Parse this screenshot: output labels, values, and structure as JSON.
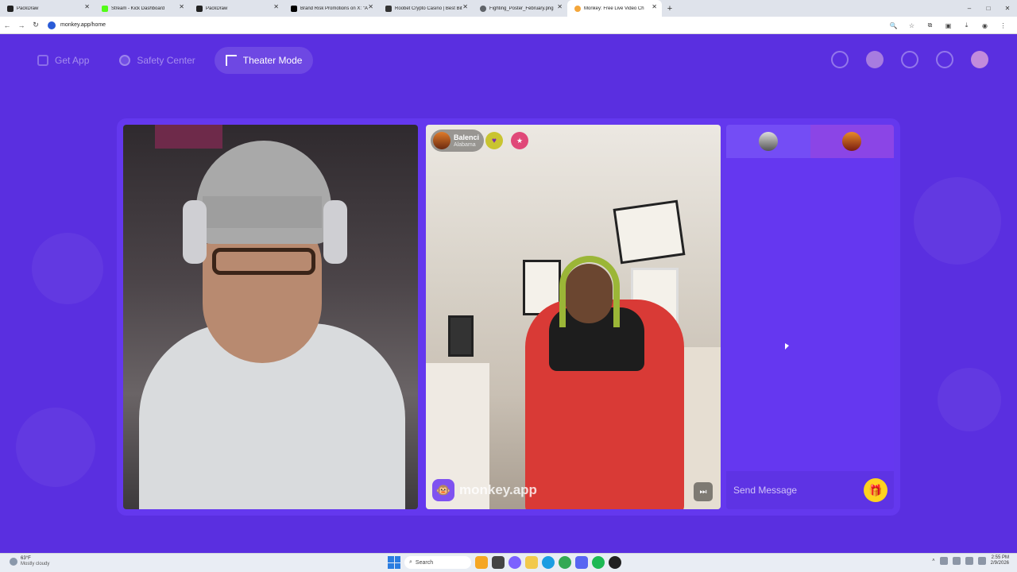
{
  "browser": {
    "tabs": [
      {
        "title": "PackDraw",
        "color": "#222222"
      },
      {
        "title": "Stream - Kick Dashboard",
        "color": "#53fc18"
      },
      {
        "title": "PackDraw",
        "color": "#222222"
      },
      {
        "title": "Brand Risk Promotions on X: \"A",
        "color": "#000000"
      },
      {
        "title": "Roobet Crypto Casino | Best Bit",
        "color": "#333333"
      },
      {
        "title": "Fighting_Poster_February.png",
        "color": "#5f6368"
      },
      {
        "title": "Monkey: Free Live Video Ch",
        "color": "#f4a63a"
      }
    ],
    "new_tab": "+",
    "url": "monkey.app/home",
    "window_controls": [
      "–",
      "□",
      "✕"
    ]
  },
  "app": {
    "nav": {
      "get_app": "Get App",
      "safety_center": "Safety Center",
      "theater_mode": "Theater Mode"
    },
    "right_video": {
      "user_name": "Balenci",
      "user_location": "Alabama",
      "watermark": "monkey.app",
      "skip_icon": "⏭"
    },
    "chat": {
      "placeholder": "Send Message",
      "gift_icon": "🎁"
    },
    "colors": {
      "background": "#5a2fe0",
      "stage": "#6438ee",
      "gift": "#ffd21f"
    }
  },
  "taskbar": {
    "weather_temp": "63°F",
    "weather_desc": "Mostly cloudy",
    "search": "Search",
    "time": "2:55 PM",
    "date": "2/9/2026"
  }
}
